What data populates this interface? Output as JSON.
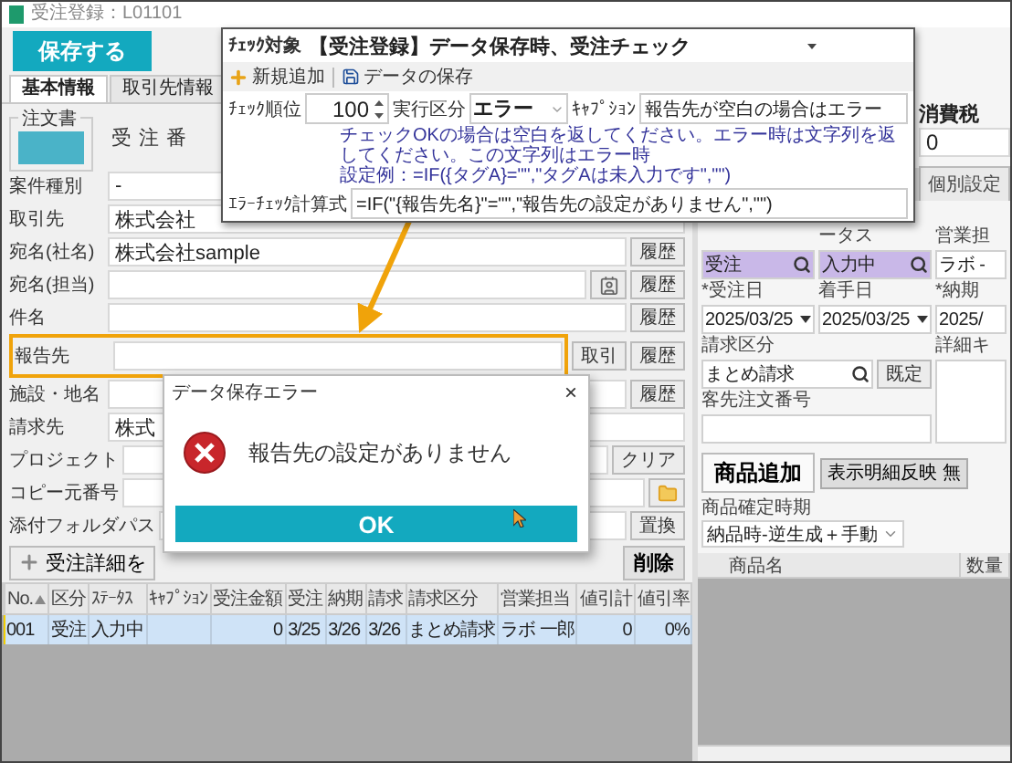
{
  "window": {
    "title": "受注登録：L01101"
  },
  "save_button": "保存する",
  "tabs": [
    {
      "label": "基本情報",
      "selected": true
    },
    {
      "label": "取引先情報",
      "selected": false
    }
  ],
  "order_doc": {
    "label": "注文書",
    "number_label": "受注番"
  },
  "form_rows": [
    {
      "label": "案件種別",
      "kind": "text",
      "value": "-",
      "highlighted": false
    },
    {
      "label": "取引先",
      "kind": "text",
      "value": "株式会社",
      "highlighted": false
    },
    {
      "label": "宛名(社名)",
      "kind": "text",
      "value": "株式会社sample",
      "buttons": [
        "履歴"
      ],
      "highlighted": false
    },
    {
      "label": "宛名(担当)",
      "kind": "contact",
      "buttons": [
        "履歴"
      ],
      "highlighted": false
    },
    {
      "label": "件名",
      "kind": "text",
      "buttons": [
        "履歴"
      ],
      "highlighted": false
    },
    {
      "label": "報告先",
      "kind": "text",
      "buttons": [
        "取引",
        "履歴"
      ],
      "highlighted": true
    },
    {
      "label": "施設・地名",
      "kind": "text",
      "buttons": [
        "履歴"
      ],
      "highlighted": false
    },
    {
      "label": "請求先",
      "kind": "text",
      "value": "株式",
      "highlighted": false
    },
    {
      "label": "プロジェクト",
      "kind": "text",
      "buttons": [
        "クリア"
      ],
      "highlighted": false
    },
    {
      "label": "コピー元番号",
      "kind": "folder",
      "highlighted": false
    },
    {
      "label": "添付フォルダパス",
      "kind": "text",
      "buttons": [
        "置換"
      ],
      "highlighted": false
    }
  ],
  "detail_button": "受注詳細を",
  "delete_button": "削除",
  "orders": {
    "columns": [
      "No.",
      "区分",
      "ｽﾃｰﾀｽ",
      "ｷｬﾌﾟｼｮﾝ",
      "受注金額",
      "受注",
      "納期",
      "請求",
      "請求区分",
      "営業担当",
      "値引計",
      "値引率"
    ],
    "rows": [
      {
        "selected": true,
        "cells": [
          "001",
          "受注",
          "入力中",
          null,
          "0",
          "3/25",
          "3/26",
          "3/26",
          "まとめ請求",
          "ラボ 一郎",
          "0",
          "0%"
        ]
      }
    ]
  },
  "right": {
    "tax_label": "消費税",
    "tax": "0",
    "tabs": [
      {
        "label": "個別設定",
        "selected": false
      }
    ],
    "status_fields": [
      {
        "kind": "lookup",
        "value": "受注"
      },
      {
        "kind": "lookup",
        "label": "ータス",
        "value": "入力中"
      },
      {
        "kind": "plain",
        "label": "営業担",
        "value": "ラボ -"
      }
    ],
    "date_fields": [
      {
        "kind": "date",
        "label": "*受注日",
        "value": "2025/03/25"
      },
      {
        "kind": "date",
        "label": "着手日",
        "value": "2025/03/25"
      },
      {
        "kind": "plain",
        "label": "*納期",
        "value": "2025/"
      }
    ],
    "billing": {
      "label": "請求区分",
      "value": "まとめ請求",
      "button": "既定"
    },
    "detail_label": "詳細キ",
    "customer_order_label": "客先注文番号",
    "add_button": "商品追加",
    "reflect_button": "表示明細反映 無",
    "timing_label": "商品確定時期",
    "timing": "納品時-逆生成＋手動",
    "columns": [
      "商品名",
      "数量"
    ]
  },
  "check_popup": {
    "target_label": "ﾁｪｯｸ対象",
    "target": "【受注登録】データ保存時、受注チェック",
    "toolbar": [
      {
        "kind": "add",
        "label": "新規追加"
      },
      {
        "kind": "save",
        "label": "データの保存"
      }
    ],
    "order_label": "ﾁｪｯｸ順位",
    "order": "100",
    "exec_label": "実行区分",
    "exec": "エラー",
    "caption_label": "ｷｬﾌﾟｼｮﾝ",
    "caption": "報告先が空白の場合はエラー",
    "help": [
      "チェックOKの場合は空白を返してください。エラー時は文字列を返してください。この文字列はエラー時",
      "設定例：=IF({タグA}=\"\",\"タグAは未入力です\",\"\")"
    ],
    "formula_label": "ｴﾗｰﾁｪｯｸ計算式",
    "formula": "=IF(\"{報告先名}\"=\"\",\"報告先の設定がありません\",\"\")"
  },
  "dialog": {
    "title": "データ保存エラー",
    "close": "×",
    "message": "報告先の設定がありません",
    "ok": "OK"
  }
}
